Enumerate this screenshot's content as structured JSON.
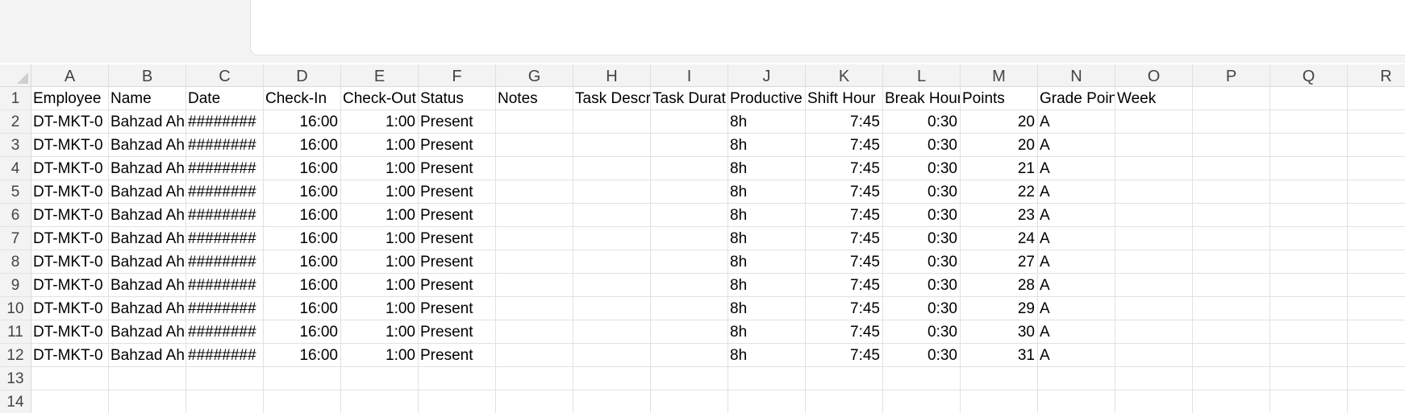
{
  "columns": [
    "A",
    "B",
    "C",
    "D",
    "E",
    "F",
    "G",
    "H",
    "I",
    "J",
    "K",
    "L",
    "M",
    "N",
    "O",
    "P",
    "Q",
    "R"
  ],
  "row_numbers": [
    "1",
    "2",
    "3",
    "4",
    "5",
    "6",
    "7",
    "8",
    "9",
    "10",
    "11",
    "12",
    "13",
    "14"
  ],
  "rows": [
    [
      "Employee",
      "Name",
      "Date",
      "Check-In",
      "Check-Out",
      "Status",
      "Notes",
      "Task Descr",
      "Task Durat",
      "Productive",
      "Shift Hour",
      "Break Hour",
      "Points",
      "Grade Poin",
      "Week",
      "",
      "",
      ""
    ],
    [
      "DT-MKT-0",
      "Bahzad Ah",
      "########",
      "16:00",
      "1:00",
      "Present",
      "",
      "",
      "",
      "8h",
      "7:45",
      "0:30",
      "20",
      "A",
      "",
      "",
      "",
      ""
    ],
    [
      "DT-MKT-0",
      "Bahzad Ah",
      "########",
      "16:00",
      "1:00",
      "Present",
      "",
      "",
      "",
      "8h",
      "7:45",
      "0:30",
      "20",
      "A",
      "",
      "",
      "",
      ""
    ],
    [
      "DT-MKT-0",
      "Bahzad Ah",
      "########",
      "16:00",
      "1:00",
      "Present",
      "",
      "",
      "",
      "8h",
      "7:45",
      "0:30",
      "21",
      "A",
      "",
      "",
      "",
      ""
    ],
    [
      "DT-MKT-0",
      "Bahzad Ah",
      "########",
      "16:00",
      "1:00",
      "Present",
      "",
      "",
      "",
      "8h",
      "7:45",
      "0:30",
      "22",
      "A",
      "",
      "",
      "",
      ""
    ],
    [
      "DT-MKT-0",
      "Bahzad Ah",
      "########",
      "16:00",
      "1:00",
      "Present",
      "",
      "",
      "",
      "8h",
      "7:45",
      "0:30",
      "23",
      "A",
      "",
      "",
      "",
      ""
    ],
    [
      "DT-MKT-0",
      "Bahzad Ah",
      "########",
      "16:00",
      "1:00",
      "Present",
      "",
      "",
      "",
      "8h",
      "7:45",
      "0:30",
      "24",
      "A",
      "",
      "",
      "",
      ""
    ],
    [
      "DT-MKT-0",
      "Bahzad Ah",
      "########",
      "16:00",
      "1:00",
      "Present",
      "",
      "",
      "",
      "8h",
      "7:45",
      "0:30",
      "27",
      "A",
      "",
      "",
      "",
      ""
    ],
    [
      "DT-MKT-0",
      "Bahzad Ah",
      "########",
      "16:00",
      "1:00",
      "Present",
      "",
      "",
      "",
      "8h",
      "7:45",
      "0:30",
      "28",
      "A",
      "",
      "",
      "",
      ""
    ],
    [
      "DT-MKT-0",
      "Bahzad Ah",
      "########",
      "16:00",
      "1:00",
      "Present",
      "",
      "",
      "",
      "8h",
      "7:45",
      "0:30",
      "29",
      "A",
      "",
      "",
      "",
      ""
    ],
    [
      "DT-MKT-0",
      "Bahzad Ah",
      "########",
      "16:00",
      "1:00",
      "Present",
      "",
      "",
      "",
      "8h",
      "7:45",
      "0:30",
      "30",
      "A",
      "",
      "",
      "",
      ""
    ],
    [
      "DT-MKT-0",
      "Bahzad Ah",
      "########",
      "16:00",
      "1:00",
      "Present",
      "",
      "",
      "",
      "8h",
      "7:45",
      "0:30",
      "31",
      "A",
      "",
      "",
      "",
      ""
    ],
    [
      "",
      "",
      "",
      "",
      "",
      "",
      "",
      "",
      "",
      "",
      "",
      "",
      "",
      "",
      "",
      "",
      "",
      ""
    ],
    [
      "",
      "",
      "",
      "",
      "",
      "",
      "",
      "",
      "",
      "",
      "",
      "",
      "",
      "",
      "",
      "",
      "",
      ""
    ]
  ],
  "right_aligned_columns": [
    "D",
    "E",
    "K",
    "L",
    "M"
  ],
  "colors": {
    "header_bg": "#f3f3f3",
    "gridline": "#e1e1e1"
  }
}
